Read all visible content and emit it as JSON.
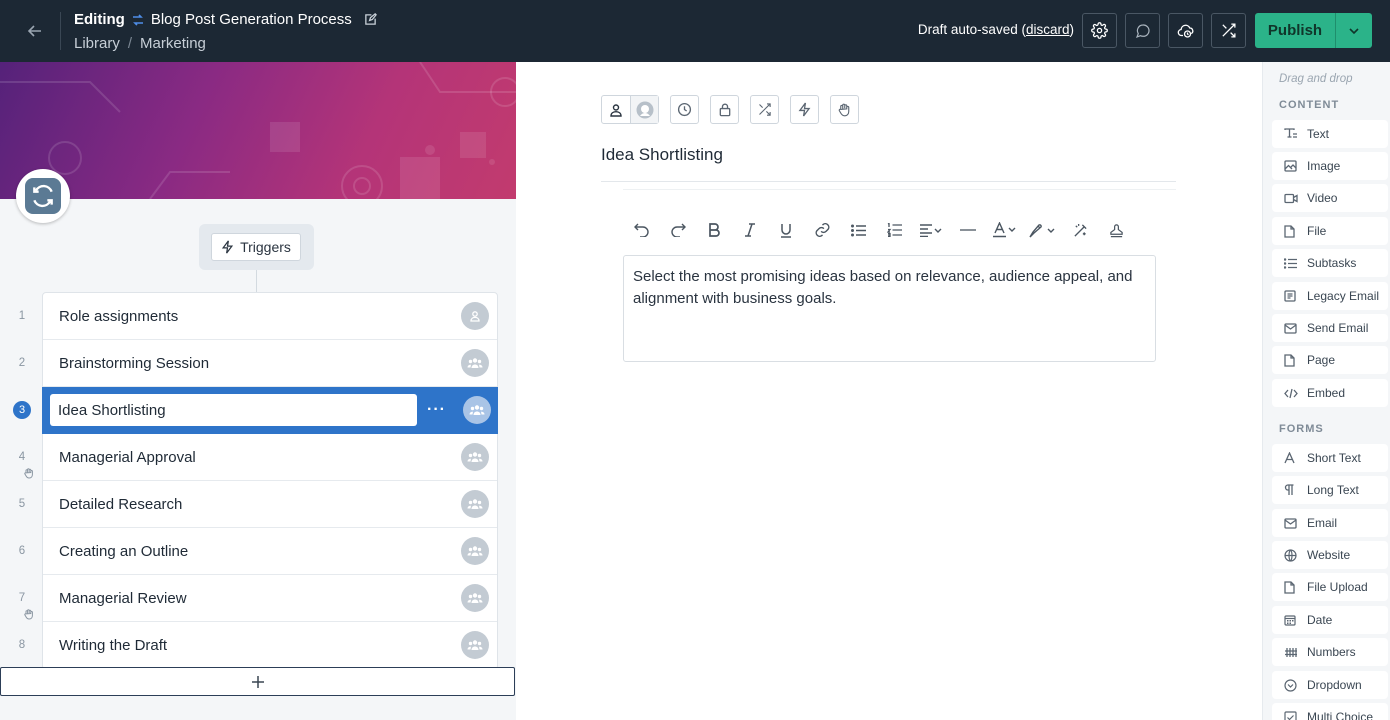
{
  "header": {
    "editing_label": "Editing",
    "workflow_name": "Blog Post Generation Process",
    "breadcrumb": [
      "Library",
      "Marketing"
    ],
    "breadcrumb_sep": "/",
    "draft_status": "Draft auto-saved",
    "discard_label": "discard",
    "publish_label": "Publish"
  },
  "triggers_label": "Triggers",
  "steps": [
    {
      "num": "1",
      "name": "Role assignments",
      "avatar": "user-icon"
    },
    {
      "num": "2",
      "name": "Brainstorming Session",
      "avatar": "group-icon"
    },
    {
      "num": "3",
      "name": "Idea Shortlisting",
      "avatar": "group-icon",
      "active": true
    },
    {
      "num": "4",
      "name": "Managerial Approval",
      "avatar": "group-icon",
      "hand": true
    },
    {
      "num": "5",
      "name": "Detailed Research",
      "avatar": "group-icon"
    },
    {
      "num": "6",
      "name": "Creating an Outline",
      "avatar": "group-icon"
    },
    {
      "num": "7",
      "name": "Managerial Review",
      "avatar": "group-icon",
      "hand": true
    },
    {
      "num": "8",
      "name": "Writing the Draft",
      "avatar": "group-icon"
    }
  ],
  "editor": {
    "task_title": "Idea Shortlisting",
    "body": "Select the most promising ideas based on relevance, audience appeal, and alignment with business goals."
  },
  "palette": {
    "hint": "Drag and drop",
    "content_heading": "CONTENT",
    "content": [
      "Text",
      "Image",
      "Video",
      "File",
      "Subtasks",
      "Legacy Email",
      "Send Email",
      "Page",
      "Embed"
    ],
    "forms_heading": "FORMS",
    "forms": [
      "Short Text",
      "Long Text",
      "Email",
      "Website",
      "File Upload",
      "Date",
      "Numbers",
      "Dropdown",
      "Multi Choice"
    ]
  },
  "colors": {
    "header_bg": "#1c2834",
    "publish": "#2bb389",
    "active_step": "#2e74c9"
  }
}
